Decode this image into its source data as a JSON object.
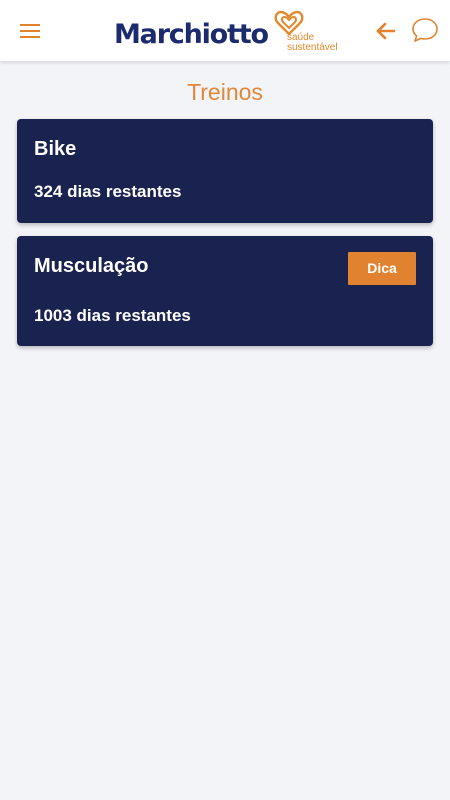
{
  "header": {
    "menu_icon": "hamburger-menu-icon",
    "logo": {
      "word": "Marchiotto",
      "tagline_line1": "saúde",
      "tagline_line2": "sustentável",
      "heart_icon": "heart-outline-icon"
    },
    "back_icon": "arrow-left-icon",
    "chat_icon": "chat-bubble-icon"
  },
  "page": {
    "title": "Treinos"
  },
  "workouts": [
    {
      "name": "Bike",
      "remaining": "324 dias restantes"
    },
    {
      "name": "Musculação",
      "remaining": "1003 dias restantes",
      "tip_label": "Dica"
    }
  ],
  "colors": {
    "accent": "#e0873a",
    "brand_navy": "#1b2b6e",
    "card_bg": "#1a234f",
    "page_bg": "#f3f4f8",
    "header_bg": "#ffffff",
    "button_orange": "#e0822f"
  }
}
